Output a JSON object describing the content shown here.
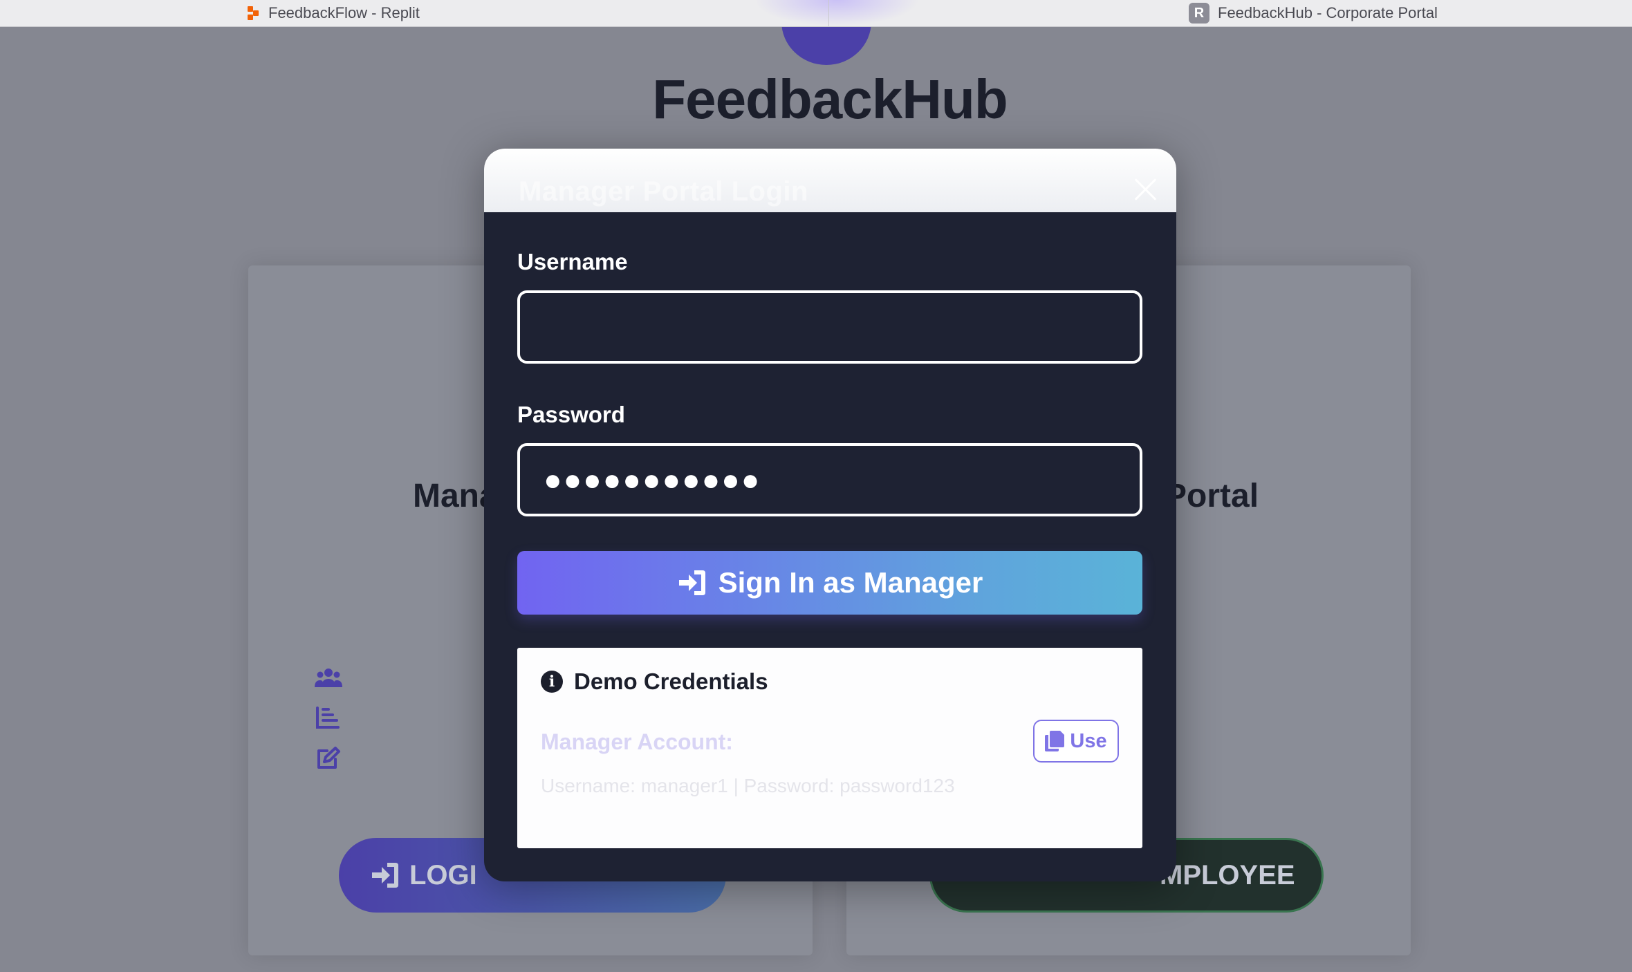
{
  "browser": {
    "tabs": [
      {
        "title": "FeedbackFlow - Replit"
      },
      {
        "title": "FeedbackHub - Corporate Portal"
      }
    ],
    "active_tab_favicon_letter": "R"
  },
  "background_page": {
    "app_title": "FeedbackHub",
    "left_card_title_partial": "Mana",
    "right_card_title_partial": "Portal",
    "left_button_label_partial": "LOGI",
    "right_button_label_partial": "MPLOYEE"
  },
  "modal": {
    "title": "Manager Portal Login",
    "username": {
      "label": "Username",
      "value": "",
      "placeholder": ""
    },
    "password": {
      "label": "Password",
      "masked_value": "●●●●●●●●●●●"
    },
    "signin_label": "Sign In as Manager",
    "demo": {
      "heading": "Demo Credentials",
      "account_label": "Manager Account:",
      "credentials_text": "Username: manager1 | Password: password123",
      "use_label": "Use"
    }
  },
  "colors": {
    "modal_bg": "#1e2233",
    "accent_start": "#7164f1",
    "accent_end": "#5ab3d8",
    "use_button": "#7f74e6"
  }
}
